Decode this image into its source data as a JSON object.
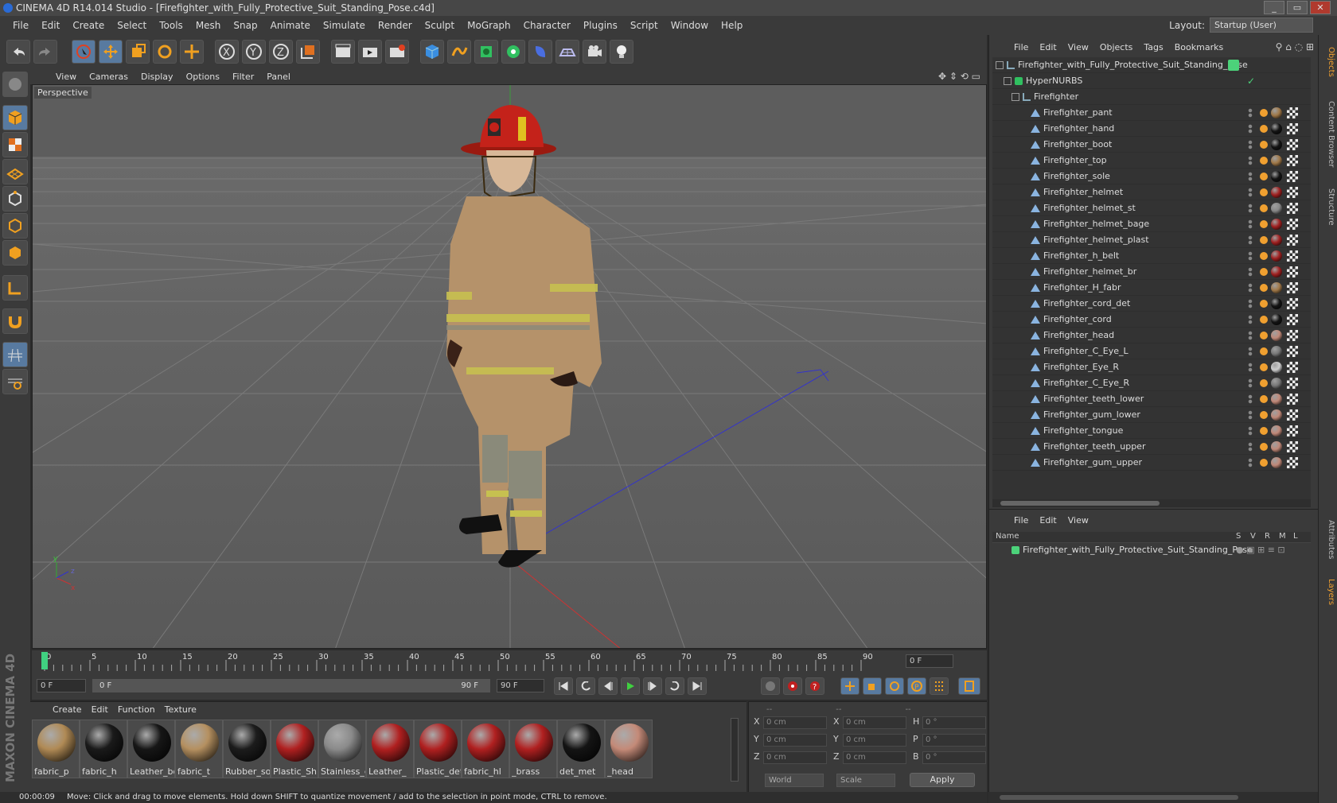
{
  "window": {
    "title": "CINEMA 4D R14.014 Studio - [Firefighter_with_Fully_Protective_Suit_Standing_Pose.c4d]",
    "buttons": [
      "_",
      "▭",
      "✕"
    ]
  },
  "menubar": {
    "items": [
      "File",
      "Edit",
      "Create",
      "Select",
      "Tools",
      "Mesh",
      "Snap",
      "Animate",
      "Simulate",
      "Render",
      "Sculpt",
      "MoGraph",
      "Character",
      "Plugins",
      "Script",
      "Window",
      "Help"
    ]
  },
  "layout": {
    "label": "Layout:",
    "value": "Startup (User)"
  },
  "viewport": {
    "menu": [
      "View",
      "Cameras",
      "Display",
      "Options",
      "Filter",
      "Panel"
    ],
    "label": "Perspective"
  },
  "timeline": {
    "ticks": [
      "0",
      "5",
      "10",
      "15",
      "20",
      "25",
      "30",
      "35",
      "40",
      "45",
      "50",
      "55",
      "60",
      "65",
      "70",
      "75",
      "80",
      "85",
      "90"
    ],
    "current_frame": "0 F"
  },
  "frames": {
    "start": "0 F",
    "range_start": "0 F",
    "range_end": "90 F",
    "end": "90 F"
  },
  "materials": {
    "menu": [
      "Create",
      "Edit",
      "Function",
      "Texture"
    ],
    "brand": "MAXON CINEMA 4D",
    "items": [
      {
        "label": "fabric_p",
        "color": "#b08a55"
      },
      {
        "label": "fabric_h",
        "color": "#1a1a1a"
      },
      {
        "label": "Leather_bo",
        "color": "#161616"
      },
      {
        "label": "fabric_t",
        "color": "#b59060"
      },
      {
        "label": "Rubber_so",
        "color": "#1c1c1c"
      },
      {
        "label": "Plastic_Shir",
        "color": "#b02020"
      },
      {
        "label": "Stainless_d",
        "color": "#8a8a8a"
      },
      {
        "label": "Leather_",
        "color": "#b02020"
      },
      {
        "label": "Plastic_det",
        "color": "#b02020"
      },
      {
        "label": "fabric_hl",
        "color": "#b02020"
      },
      {
        "label": "_brass",
        "color": "#b02020"
      },
      {
        "label": "det_met",
        "color": "#141414"
      },
      {
        "label": "_head",
        "color": "#c48a78"
      }
    ]
  },
  "coords": {
    "headers": [
      "--",
      "--",
      "--"
    ],
    "rows": [
      {
        "a": "X",
        "av": "0 cm",
        "b": "X",
        "bv": "0 cm",
        "c": "H",
        "cv": "0 °"
      },
      {
        "a": "Y",
        "av": "0 cm",
        "b": "Y",
        "bv": "0 cm",
        "c": "P",
        "cv": "0 °"
      },
      {
        "a": "Z",
        "av": "0 cm",
        "b": "Z",
        "bv": "0 cm",
        "c": "B",
        "cv": "0 °"
      }
    ],
    "mode": "World",
    "scale": "Scale",
    "apply": "Apply"
  },
  "status": {
    "time": "00:00:09",
    "message": "Move: Click and drag to move elements. Hold down SHIFT to quantize movement / add to the selection in point mode, CTRL to remove."
  },
  "objects": {
    "menu": [
      "File",
      "Edit",
      "View",
      "Objects",
      "Tags",
      "Bookmarks"
    ],
    "root": "Firefighter_with_Fully_Protective_Suit_Standing_Pose",
    "hypernurbs": "HyperNURBS",
    "group": "Firefighter",
    "children": [
      {
        "name": "Firefighter_pant",
        "mat": "#a07848"
      },
      {
        "name": "Firefighter_hand",
        "mat": "#141414"
      },
      {
        "name": "Firefighter_boot",
        "mat": "#141414"
      },
      {
        "name": "Firefighter_top",
        "mat": "#a07848"
      },
      {
        "name": "Firefighter_sole",
        "mat": "#141414"
      },
      {
        "name": "Firefighter_helmet",
        "mat": "#a02020"
      },
      {
        "name": "Firefighter_helmet_st",
        "mat": "#888888"
      },
      {
        "name": "Firefighter_helmet_bage",
        "mat": "#a02020"
      },
      {
        "name": "Firefighter_helmet_plast",
        "mat": "#a02020"
      },
      {
        "name": "Firefighter_h_belt",
        "mat": "#a02020"
      },
      {
        "name": "Firefighter_helmet_br",
        "mat": "#a02020"
      },
      {
        "name": "Firefighter_H_fabr",
        "mat": "#a07848"
      },
      {
        "name": "Firefighter_cord_det",
        "mat": "#141414"
      },
      {
        "name": "Firefighter_cord",
        "mat": "#141414"
      },
      {
        "name": "Firefighter_head",
        "mat": "#c08878"
      },
      {
        "name": "Firefighter_C_Eye_L",
        "mat": "#777777"
      },
      {
        "name": "Firefighter_Eye_R",
        "mat": "#cccccc"
      },
      {
        "name": "Firefighter_C_Eye_R",
        "mat": "#777777"
      },
      {
        "name": "Firefighter_teeth_lower",
        "mat": "#c08878"
      },
      {
        "name": "Firefighter_gum_lower",
        "mat": "#c08878"
      },
      {
        "name": "Firefighter_tongue",
        "mat": "#c08878"
      },
      {
        "name": "Firefighter_teeth_upper",
        "mat": "#c08878"
      },
      {
        "name": "Firefighter_gum_upper",
        "mat": "#c08878"
      }
    ]
  },
  "layers": {
    "menu": [
      "File",
      "Edit",
      "View"
    ],
    "columns": [
      "Name",
      "S",
      "V",
      "R",
      "M",
      "L"
    ],
    "row": "Firefighter_with_Fully_Protective_Suit_Standing_Pose"
  },
  "side_tabs": [
    "Objects",
    "Content Browser",
    "Structure",
    "Attributes",
    "Layers"
  ],
  "colors": {
    "accent": "#587aa0",
    "orange": "#f0a030",
    "green_layer": "#4cd27a"
  }
}
